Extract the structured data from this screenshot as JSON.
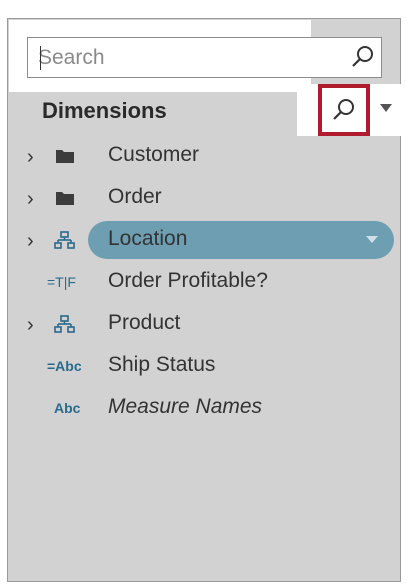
{
  "search": {
    "placeholder": "Search",
    "value": ""
  },
  "section": {
    "title": "Dimensions"
  },
  "items": [
    {
      "label": "Customer",
      "icon": "folder-icon",
      "expandable": true
    },
    {
      "label": "Order",
      "icon": "folder-icon",
      "expandable": true
    },
    {
      "label": "Location",
      "icon": "hierarchy-icon",
      "expandable": true,
      "selected": true
    },
    {
      "label": "Order Profitable?",
      "icon": "boolean-field-icon",
      "type_label": "=T|F",
      "expandable": false
    },
    {
      "label": "Product",
      "icon": "hierarchy-icon",
      "expandable": true
    },
    {
      "label": "Ship Status",
      "icon": "calculated-string-icon",
      "type_label": "=Abc",
      "expandable": false
    },
    {
      "label": "Measure Names",
      "icon": "string-icon",
      "type_label": "Abc",
      "expandable": false,
      "italic": true
    }
  ],
  "colors": {
    "panel": "#d2d2d2",
    "selected_pill": "#6e9eb2",
    "highlight_box": "#b01c2e",
    "type_icon": "#2b6a8c"
  }
}
